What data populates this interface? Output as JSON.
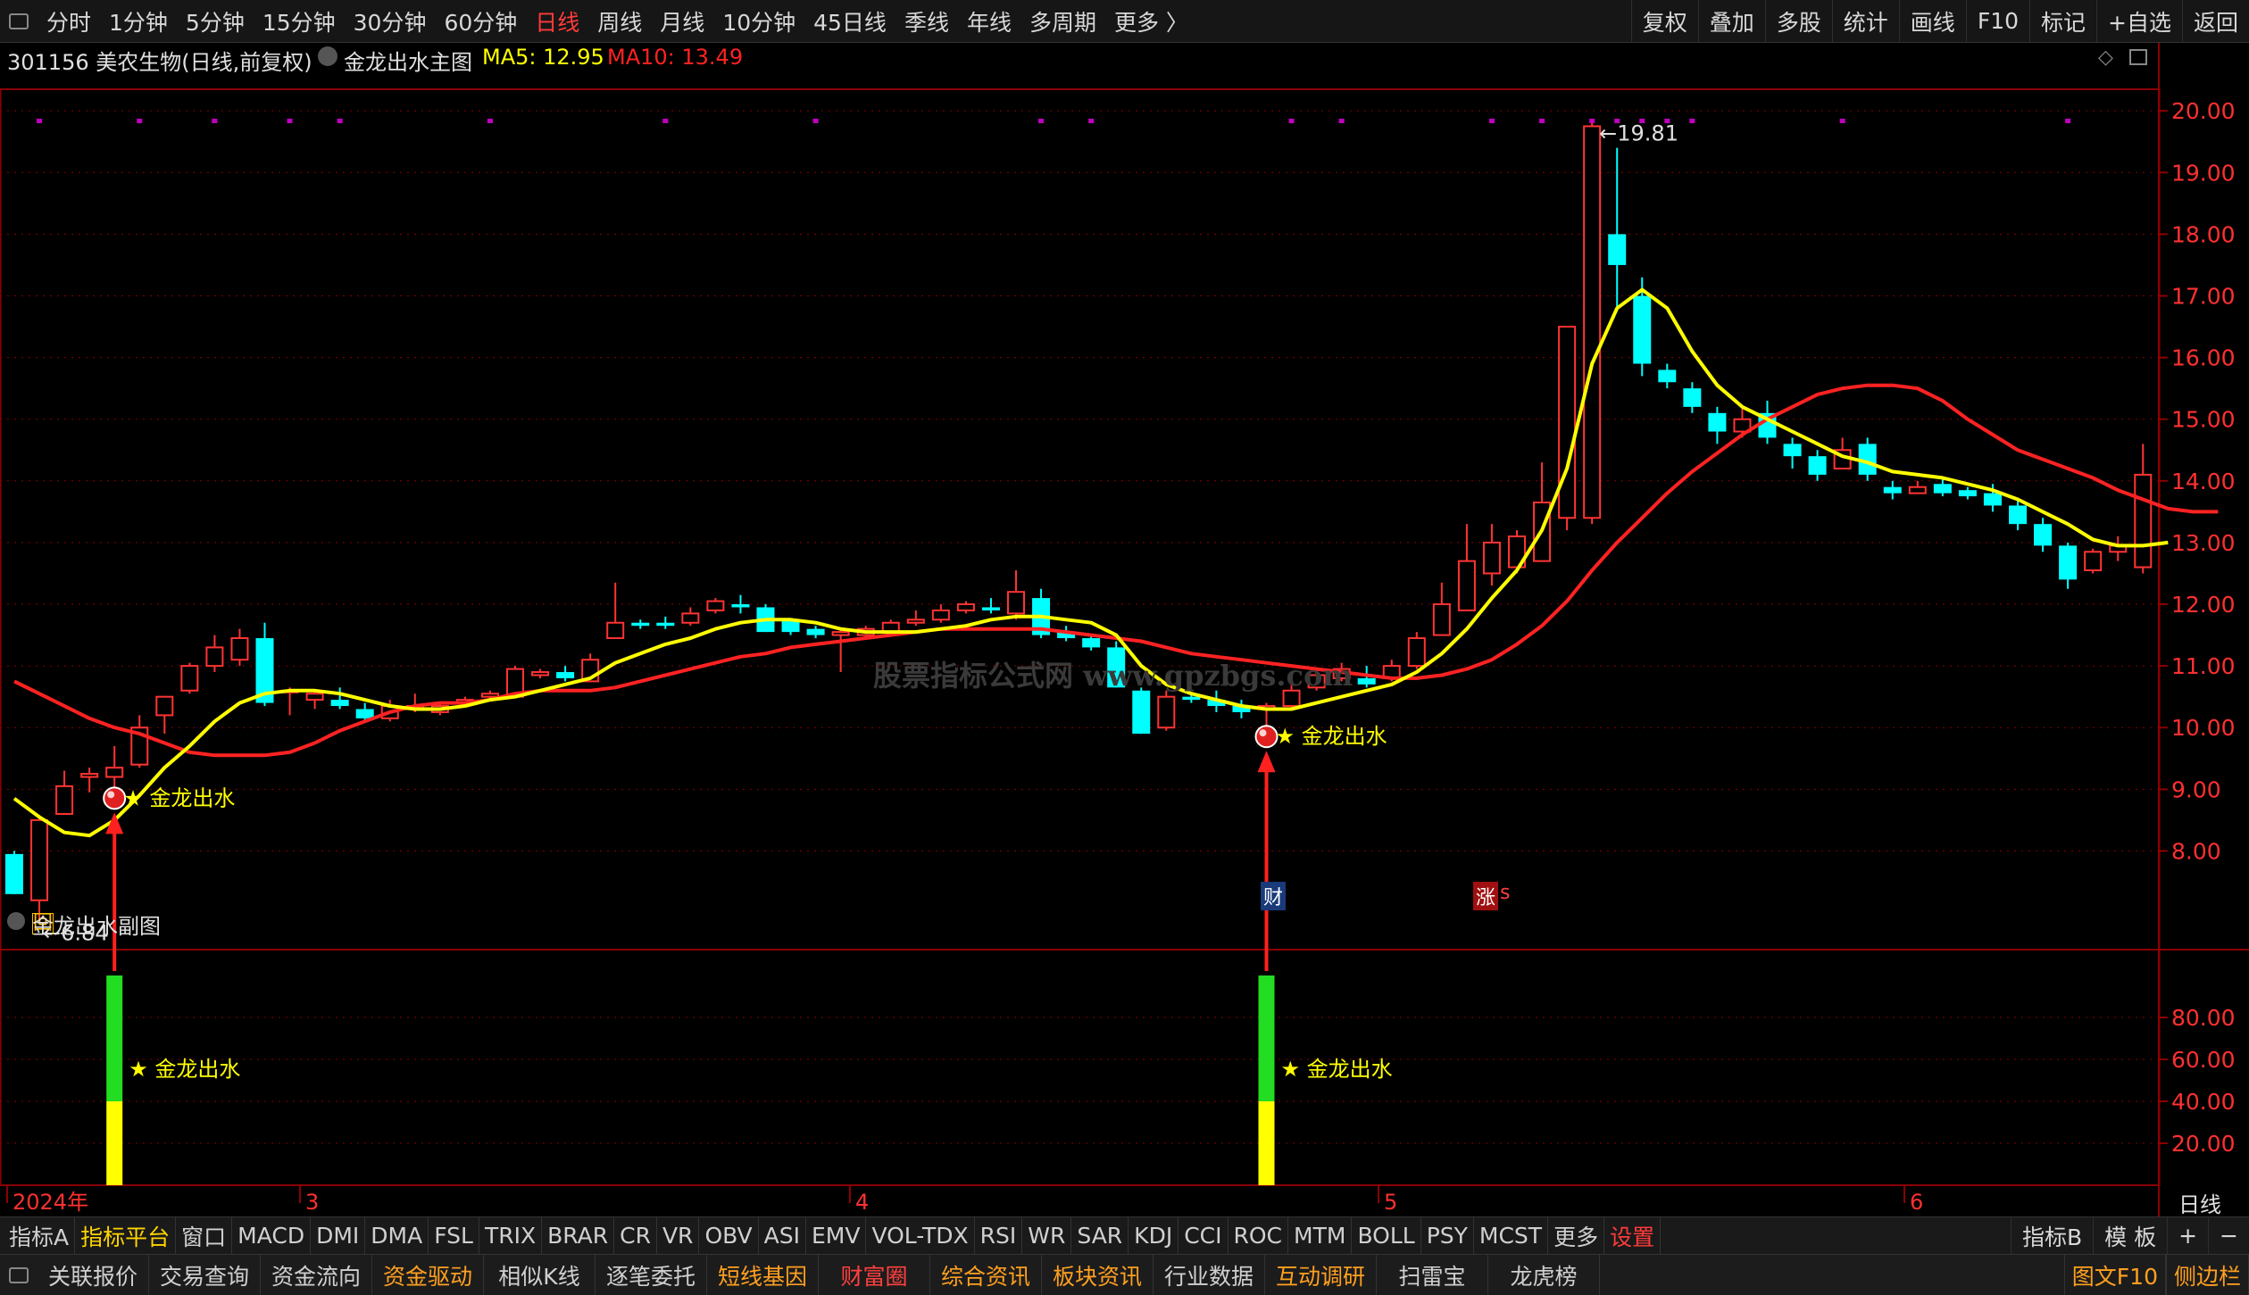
{
  "top_periods": [
    {
      "label": "分时"
    },
    {
      "label": "1分钟"
    },
    {
      "label": "5分钟"
    },
    {
      "label": "15分钟"
    },
    {
      "label": "30分钟"
    },
    {
      "label": "60分钟"
    },
    {
      "label": "日线",
      "active": true
    },
    {
      "label": "周线"
    },
    {
      "label": "月线"
    },
    {
      "label": "10分钟"
    },
    {
      "label": "45日线"
    },
    {
      "label": "季线"
    },
    {
      "label": "年线"
    },
    {
      "label": "多周期"
    },
    {
      "label": "更多 〉"
    }
  ],
  "top_right": [
    "复权",
    "叠加",
    "多股",
    "统计",
    "画线",
    "F10",
    "标记",
    "+自选",
    "返回"
  ],
  "header": {
    "stock": "301156 美农生物(日线,前复权)",
    "indicator": "金龙出水主图",
    "ma5": "MA5: 12.95",
    "ma10": "MA10: 13.49"
  },
  "colors": {
    "up": "#ff3333",
    "down": "#00ffff",
    "ma5": "#ffff00",
    "ma10": "#ff2222",
    "grid": "#8b0000",
    "magenta": "#c000c0"
  },
  "sub_panel": {
    "title": "金龙出水副图"
  },
  "signal_label": "★ 金龙出水",
  "watermark": "股票指标公式网 www.gpzbgs.com",
  "markers": {
    "bottom_left": "回",
    "cai": "财",
    "zhang": "涨",
    "s": "s"
  },
  "period_label": "日线",
  "x_labels": [
    "2024年",
    "3",
    "4",
    "5",
    "6"
  ],
  "tabs": [
    "指标A",
    "指标平台",
    "窗口",
    "MACD",
    "DMI",
    "DMA",
    "FSL",
    "TRIX",
    "BRAR",
    "CR",
    "VR",
    "OBV",
    "ASI",
    "EMV",
    "VOL-TDX",
    "RSI",
    "WR",
    "SAR",
    "KDJ",
    "CCI",
    "ROC",
    "MTM",
    "BOLL",
    "PSY",
    "MCST",
    "更多",
    "设置"
  ],
  "tabs_right": [
    "指标B",
    "模 板",
    "+",
    "−"
  ],
  "func_buttons": [
    "关联报价",
    "交易查询",
    "资金流向",
    "资金驱动",
    "相似K线",
    "逐笔委托",
    "短线基因",
    "财富圈",
    "综合资讯",
    "板块资讯",
    "行业数据",
    "互动调研",
    "扫雷宝",
    "龙虎榜"
  ],
  "func_right": [
    "图文F10",
    "侧边栏"
  ],
  "chart_data": {
    "type": "candlestick",
    "ylim": [
      6.4,
      20.35
    ],
    "y_ticks": [
      "20.00",
      "19.00",
      "18.00",
      "17.00",
      "16.00",
      "15.00",
      "14.00",
      "13.00",
      "12.00",
      "11.00",
      "10.00",
      "9.00",
      "8.00"
    ],
    "sub_ylim": [
      0,
      100
    ],
    "sub_y_ticks": [
      "80.00",
      "60.00",
      "40.00",
      "20.00"
    ],
    "annotations": {
      "high": "19.81",
      "low": "6.84"
    },
    "candles": [
      [
        7.95,
        7.3,
        8.0,
        7.3
      ],
      [
        7.2,
        8.5,
        8.55,
        6.84
      ],
      [
        8.6,
        9.05,
        9.3,
        8.6
      ],
      [
        9.2,
        9.25,
        9.35,
        8.95
      ],
      [
        9.2,
        9.35,
        9.7,
        9.0
      ],
      [
        9.4,
        10.0,
        10.2,
        9.35
      ],
      [
        10.2,
        10.5,
        10.5,
        9.9
      ],
      [
        10.6,
        11.0,
        11.05,
        10.55
      ],
      [
        11.0,
        11.3,
        11.5,
        10.9
      ],
      [
        11.1,
        11.45,
        11.6,
        11.0
      ],
      [
        11.45,
        10.4,
        11.7,
        10.35
      ],
      [
        10.6,
        10.6,
        10.65,
        10.2
      ],
      [
        10.45,
        10.55,
        10.6,
        10.3
      ],
      [
        10.45,
        10.35,
        10.65,
        10.3
      ],
      [
        10.3,
        10.15,
        10.4,
        10.1
      ],
      [
        10.15,
        10.35,
        10.45,
        10.1
      ],
      [
        10.3,
        10.35,
        10.55,
        10.25
      ],
      [
        10.25,
        10.35,
        10.4,
        10.2
      ],
      [
        10.4,
        10.45,
        10.5,
        10.35
      ],
      [
        10.5,
        10.55,
        10.6,
        10.45
      ],
      [
        10.5,
        10.95,
        11.0,
        10.5
      ],
      [
        10.85,
        10.9,
        10.95,
        10.8
      ],
      [
        10.9,
        10.8,
        11.0,
        10.75
      ],
      [
        10.75,
        11.1,
        11.2,
        10.75
      ],
      [
        11.45,
        11.7,
        12.35,
        11.45
      ],
      [
        11.7,
        11.65,
        11.75,
        11.6
      ],
      [
        11.7,
        11.65,
        11.8,
        11.6
      ],
      [
        11.7,
        11.85,
        11.95,
        11.65
      ],
      [
        11.9,
        12.05,
        12.1,
        11.85
      ],
      [
        12.0,
        11.95,
        12.15,
        11.85
      ],
      [
        11.95,
        11.55,
        12.0,
        11.55
      ],
      [
        11.75,
        11.55,
        11.75,
        11.5
      ],
      [
        11.6,
        11.5,
        11.65,
        11.45
      ],
      [
        11.5,
        11.55,
        11.6,
        10.9
      ],
      [
        11.5,
        11.6,
        11.65,
        11.45
      ],
      [
        11.55,
        11.7,
        11.75,
        11.5
      ],
      [
        11.7,
        11.75,
        11.9,
        11.65
      ],
      [
        11.75,
        11.9,
        12.0,
        11.7
      ],
      [
        11.9,
        12.0,
        12.05,
        11.85
      ],
      [
        11.95,
        11.9,
        12.1,
        11.85
      ],
      [
        11.85,
        12.2,
        12.55,
        11.75
      ],
      [
        12.1,
        11.5,
        12.25,
        11.45
      ],
      [
        11.55,
        11.45,
        11.65,
        11.4
      ],
      [
        11.45,
        11.3,
        11.5,
        11.25
      ],
      [
        11.3,
        10.65,
        11.4,
        10.65
      ],
      [
        10.6,
        9.9,
        10.65,
        9.9
      ],
      [
        10.0,
        10.5,
        10.6,
        9.95
      ],
      [
        10.5,
        10.45,
        10.55,
        10.4
      ],
      [
        10.45,
        10.35,
        10.6,
        10.25
      ],
      [
        10.35,
        10.25,
        10.45,
        10.15
      ],
      [
        10.3,
        10.35,
        10.4,
        10.0
      ],
      [
        10.35,
        10.6,
        10.75,
        10.3
      ],
      [
        10.65,
        10.85,
        10.95,
        10.6
      ],
      [
        10.8,
        10.95,
        11.05,
        10.75
      ],
      [
        10.8,
        10.7,
        11.0,
        10.65
      ],
      [
        10.8,
        11.0,
        11.1,
        10.75
      ],
      [
        11.0,
        11.45,
        11.55,
        10.95
      ],
      [
        11.5,
        12.0,
        12.35,
        11.5
      ],
      [
        11.9,
        12.7,
        13.3,
        11.9
      ],
      [
        12.5,
        13.0,
        13.3,
        12.3
      ],
      [
        12.6,
        13.1,
        13.2,
        12.5
      ],
      [
        12.7,
        13.65,
        14.3,
        12.7
      ],
      [
        13.4,
        16.5,
        16.5,
        13.2
      ],
      [
        13.4,
        19.75,
        19.81,
        13.3
      ],
      [
        18.0,
        17.5,
        19.4,
        16.8
      ],
      [
        17.0,
        15.9,
        17.3,
        15.7
      ],
      [
        15.8,
        15.6,
        15.9,
        15.5
      ],
      [
        15.5,
        15.2,
        15.6,
        15.1
      ],
      [
        15.1,
        14.8,
        15.2,
        14.6
      ],
      [
        14.8,
        15.0,
        15.2,
        14.7
      ],
      [
        15.1,
        14.7,
        15.3,
        14.6
      ],
      [
        14.6,
        14.4,
        14.7,
        14.2
      ],
      [
        14.4,
        14.1,
        14.5,
        14.0
      ],
      [
        14.2,
        14.5,
        14.7,
        14.2
      ],
      [
        14.6,
        14.1,
        14.7,
        14.0
      ],
      [
        13.9,
        13.8,
        14.0,
        13.7
      ],
      [
        13.8,
        13.9,
        14.0,
        13.8
      ],
      [
        13.95,
        13.8,
        14.05,
        13.75
      ],
      [
        13.85,
        13.75,
        13.9,
        13.7
      ],
      [
        13.8,
        13.6,
        13.95,
        13.5
      ],
      [
        13.6,
        13.3,
        13.7,
        13.2
      ],
      [
        13.3,
        12.95,
        13.4,
        12.85
      ],
      [
        12.95,
        12.4,
        13.0,
        12.25
      ],
      [
        12.55,
        12.85,
        12.9,
        12.5
      ],
      [
        12.85,
        12.95,
        13.1,
        12.7
      ],
      [
        12.6,
        14.1,
        14.6,
        12.5
      ]
    ],
    "ma5": [
      8.85,
      8.55,
      8.3,
      8.25,
      8.5,
      8.9,
      9.35,
      9.7,
      10.1,
      10.4,
      10.55,
      10.6,
      10.6,
      10.55,
      10.45,
      10.35,
      10.3,
      10.3,
      10.35,
      10.45,
      10.5,
      10.6,
      10.7,
      10.8,
      11.05,
      11.2,
      11.35,
      11.45,
      11.6,
      11.7,
      11.75,
      11.75,
      11.7,
      11.6,
      11.55,
      11.55,
      11.55,
      11.6,
      11.65,
      11.75,
      11.8,
      11.8,
      11.75,
      11.7,
      11.5,
      11.0,
      10.7,
      10.55,
      10.45,
      10.35,
      10.3,
      10.3,
      10.4,
      10.5,
      10.6,
      10.7,
      10.9,
      11.2,
      11.6,
      12.1,
      12.55,
      13.2,
      14.2,
      15.9,
      16.8,
      17.1,
      16.8,
      16.1,
      15.55,
      15.2,
      15.0,
      14.8,
      14.6,
      14.4,
      14.3,
      14.15,
      14.1,
      14.05,
      13.95,
      13.85,
      13.7,
      13.5,
      13.3,
      13.05,
      12.95,
      12.95,
      13.0
    ],
    "ma10": [
      10.75,
      10.55,
      10.35,
      10.15,
      10.0,
      9.9,
      9.75,
      9.6,
      9.55,
      9.55,
      9.55,
      9.6,
      9.75,
      9.95,
      10.1,
      10.25,
      10.35,
      10.4,
      10.4,
      10.45,
      10.55,
      10.6,
      10.6,
      10.6,
      10.65,
      10.75,
      10.85,
      10.95,
      11.05,
      11.15,
      11.2,
      11.3,
      11.35,
      11.4,
      11.45,
      11.5,
      11.55,
      11.6,
      11.6,
      11.6,
      11.6,
      11.6,
      11.55,
      11.5,
      11.45,
      11.4,
      11.3,
      11.2,
      11.15,
      11.1,
      11.05,
      11.0,
      10.95,
      10.9,
      10.85,
      10.8,
      10.8,
      10.85,
      10.95,
      11.1,
      11.35,
      11.65,
      12.05,
      12.55,
      13.0,
      13.4,
      13.8,
      14.15,
      14.45,
      14.75,
      15.0,
      15.2,
      15.4,
      15.5,
      15.55,
      15.55,
      15.5,
      15.3,
      15.0,
      14.75,
      14.5,
      14.35,
      14.2,
      14.05,
      13.85,
      13.7,
      13.55,
      13.5,
      13.5
    ],
    "signals": [
      4,
      50
    ],
    "magenta_dots": [
      1,
      5,
      8,
      11,
      13,
      19,
      26,
      32,
      41,
      43,
      51,
      53,
      59,
      61,
      63,
      64,
      65,
      66,
      67,
      73,
      82
    ]
  }
}
